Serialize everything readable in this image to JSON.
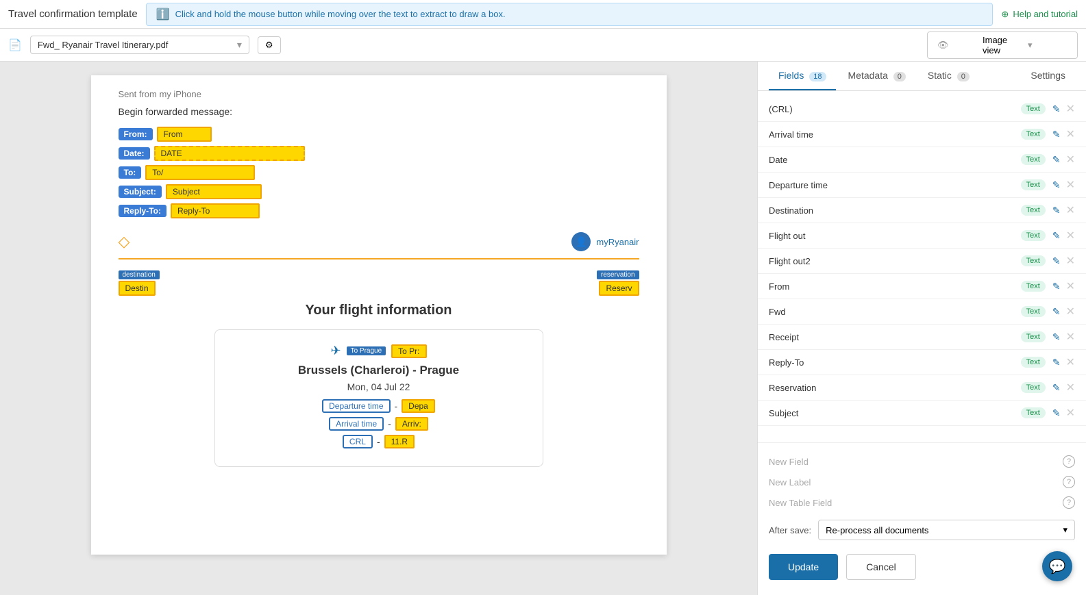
{
  "topbar": {
    "title": "Travel confirmation template",
    "info_message": "Click and hold the mouse button while moving over the text to extract to draw a box.",
    "help_label": "Help and tutorial"
  },
  "secondbar": {
    "file_name": "Fwd_ Ryanair Travel Itinerary.pdf",
    "view_label": "Image view"
  },
  "tabs": {
    "fields_label": "Fields",
    "fields_count": "18",
    "metadata_label": "Metadata",
    "metadata_count": "0",
    "static_label": "Static",
    "static_count": "0",
    "settings_label": "Settings"
  },
  "fields": [
    {
      "name": "(CRL)",
      "type": "Text"
    },
    {
      "name": "Arrival time",
      "type": "Text"
    },
    {
      "name": "Date",
      "type": "Text"
    },
    {
      "name": "Departure time",
      "type": "Text"
    },
    {
      "name": "Destination",
      "type": "Text"
    },
    {
      "name": "Flight out",
      "type": "Text"
    },
    {
      "name": "Flight out2",
      "type": "Text"
    },
    {
      "name": "From",
      "type": "Text"
    },
    {
      "name": "Fwd",
      "type": "Text"
    },
    {
      "name": "Receipt",
      "type": "Text"
    },
    {
      "name": "Reply-To",
      "type": "Text"
    },
    {
      "name": "Reservation",
      "type": "Text"
    },
    {
      "name": "Subject",
      "type": "Text"
    }
  ],
  "bottom": {
    "new_field_label": "New Field",
    "new_label_label": "New Label",
    "new_table_label": "New Table Field",
    "after_save_label": "After save:",
    "after_save_value": "Re-process all documents",
    "update_label": "Update",
    "cancel_label": "Cancel"
  },
  "document": {
    "sent_from": "Sent from my iPhone",
    "begin_fwd": "Begin forwarded message:",
    "from_label": "From:",
    "from_value": "From",
    "date_label": "Date:",
    "date_value": "DATE",
    "to_label": "To:",
    "to_value": "To/",
    "subject_label": "Subject:",
    "subject_value": "Subject",
    "reply_label": "Reply-To:",
    "reply_value": "Reply-To",
    "user_label": "myRyanair",
    "dest_badge": "destination",
    "dest_value": "Destin",
    "reserv_badge": "reservation",
    "reserv_value": "Reserv",
    "flight_title": "Your flight information",
    "to_prague_badge": "To Prague",
    "to_prague_value": "To Pr:",
    "route": "Brussels (Charleroi) - Prague",
    "date_line": "Mon, 04 Jul 22",
    "departure_label": "Departure time",
    "departure_value": "Depa",
    "arrival_label": "Arrival time",
    "arrival_value": "Arriv:",
    "crl_label": "CRL",
    "crl_value": "11.R"
  }
}
